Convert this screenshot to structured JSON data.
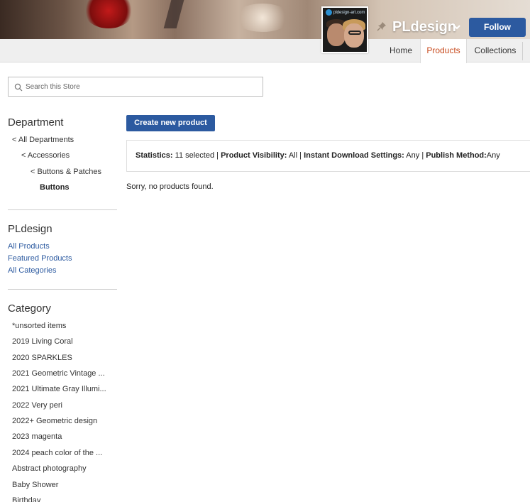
{
  "header": {
    "store_name": "PLdesign",
    "avatar_logo_text": "pldesign-art.com",
    "follow_label": "Follow",
    "tabs": [
      {
        "label": "Home"
      },
      {
        "label": "Products",
        "active": true
      },
      {
        "label": "Collections"
      }
    ],
    "colors": {
      "accent": "#2c5aa0",
      "active_tab": "#c84b1e"
    }
  },
  "search": {
    "placeholder": "Search this Store",
    "value": ""
  },
  "sidebar": {
    "department": {
      "heading": "Department",
      "crumbs": [
        "< All Departments",
        "< Accessories",
        "< Buttons & Patches"
      ],
      "current": "Buttons"
    },
    "store": {
      "heading": "PLdesign",
      "links": [
        "All Products",
        "Featured Products",
        "All Categories"
      ]
    },
    "category": {
      "heading": "Category",
      "items": [
        "*unsorted items",
        "2019 Living Coral",
        "2020 SPARKLES",
        "2021 Geometric Vintage ...",
        "2021 Ultimate Gray Illumi...",
        "2022 Very peri",
        "2022+ Geometric design",
        "2023 magenta",
        "2024 peach color of the ...",
        "Abstract photography",
        "Baby Shower",
        "Birthday"
      ]
    }
  },
  "main": {
    "create_label": "Create new product",
    "stats": {
      "statistics_label": "Statistics:",
      "statistics_value": "11 selected",
      "visibility_label": "Product Visibility:",
      "visibility_value": "All",
      "download_label": "Instant Download Settings:",
      "download_value": "Any",
      "publish_label": "Publish Method:",
      "publish_value": "Any",
      "separator": "|"
    },
    "empty_message": "Sorry, no products found."
  }
}
